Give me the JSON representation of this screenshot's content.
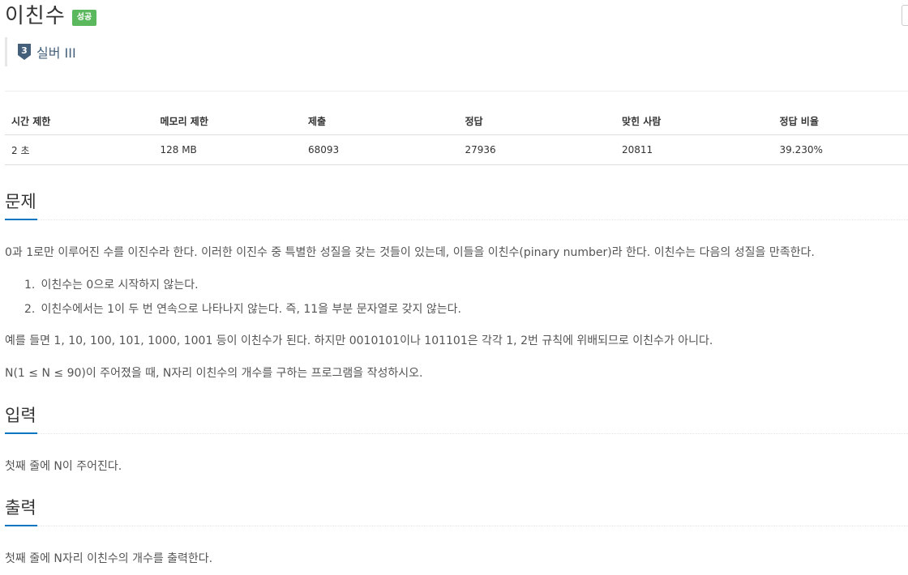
{
  "problem": {
    "title": "이친수",
    "status_label": "성공",
    "tier_number": "3",
    "tier_name": "실버 III"
  },
  "colors": {
    "success": "#5cb85c",
    "tier": "#435f7a",
    "accent": "#0076c0"
  },
  "info_table": {
    "headers": [
      "시간 제한",
      "메모리 제한",
      "제출",
      "정답",
      "맞힌 사람",
      "정답 비율"
    ],
    "values": [
      "2 초",
      "128 MB",
      "68093",
      "27936",
      "20811",
      "39.230%"
    ]
  },
  "sections": {
    "description": {
      "heading": "문제",
      "intro": "0과 1로만 이루어진 수를 이진수라 한다. 이러한 이진수 중 특별한 성질을 갖는 것들이 있는데, 이들을 이친수(pinary number)라 한다. 이친수는 다음의 성질을 만족한다.",
      "rules": [
        {
          "num": "1.",
          "text": "이친수는 0으로 시작하지 않는다."
        },
        {
          "num": "2.",
          "text": "이친수에서는 1이 두 번 연속으로 나타나지 않는다. 즉, 11을 부분 문자열로 갖지 않는다."
        }
      ],
      "example": "예를 들면 1, 10, 100, 101, 1000, 1001 등이 이친수가 된다. 하지만 0010101이나 101101은 각각 1, 2번 규칙에 위배되므로 이친수가 아니다.",
      "task": "N(1 ≤ N ≤ 90)이 주어졌을 때, N자리 이친수의 개수를 구하는 프로그램을 작성하시오."
    },
    "input": {
      "heading": "입력",
      "text": "첫째 줄에 N이 주어진다."
    },
    "output": {
      "heading": "출력",
      "text": "첫째 줄에 N자리 이친수의 개수를 출력한다."
    }
  }
}
